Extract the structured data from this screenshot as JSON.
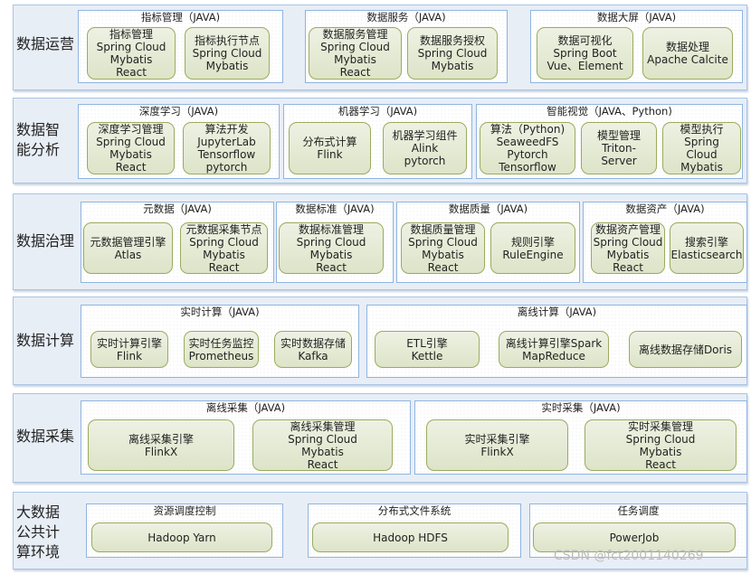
{
  "layers": [
    {
      "label": "数据运营",
      "groups": [
        {
          "title": "指标管理（JAVA)",
          "items": [
            "指标管理\nSpring Cloud\nMybatis\nReact",
            "指标执行节点\nSpring Cloud\nMybatis"
          ]
        },
        {
          "title": "数据服务（JAVA)",
          "items": [
            "数据服务管理\nSpring Cloud\nMybatis\nReact",
            "数据服务授权\nSpring Cloud\nMybatis"
          ]
        },
        {
          "title": "数据大屏（JAVA)",
          "items": [
            "数据可视化\nSpring Boot\nVue、Element",
            "数据处理\nApache Calcite"
          ]
        }
      ]
    },
    {
      "label": "数据智\n能分析",
      "groups": [
        {
          "title": "深度学习（JAVA)",
          "items": [
            "深度学习管理\nSpring Cloud\nMybatis\nReact",
            "算法开发\nJupyterLab\nTensorflow\npytorch"
          ]
        },
        {
          "title": "机器学习（JAVA)",
          "items": [
            "分布式计算\nFlink",
            "机器学习组件\nAlink\npytorch"
          ]
        },
        {
          "title": "智能视觉（JAVA、Python)",
          "items": [
            "算法（Python)\nSeaweedFS\nPytorch\nTensorflow",
            "模型管理\nTriton-\nServer",
            "模型执行\nSpring\nCloud\nMybatis"
          ]
        }
      ]
    },
    {
      "label": "数据治理",
      "groups": [
        {
          "title": "元数据（JAVA)",
          "items": [
            "元数据管理引擎\nAtlas",
            "元数据采集节点\nSpring Cloud\nMybatis\nReact"
          ]
        },
        {
          "title": "数据标准（JAVA)",
          "items": [
            "数据标准管理\nSpring Cloud\nMybatis\nReact"
          ]
        },
        {
          "title": "数据质量（JAVA)",
          "items": [
            "数据质量管理\nSpring Cloud\nMybatis\nReact",
            "规则引擎\nRuleEngine"
          ]
        },
        {
          "title": "数据资产（JAVA)",
          "items": [
            "数据资产管理\nSpring Cloud\nMybatis\nReact",
            "搜索引擎\nElasticsearch"
          ]
        }
      ]
    },
    {
      "label": "数据计算",
      "groups": [
        {
          "title": "实时计算（JAVA)",
          "items": [
            "实时计算引擎\nFlink",
            "实时任务监控\nPrometheus",
            "实时数据存储\nKafka"
          ]
        },
        {
          "title": "离线计算（JAVA)",
          "items": [
            "ETL引擎\nKettle",
            "离线计算引擎Spark\nMapReduce",
            "离线数据存储Doris"
          ]
        }
      ]
    },
    {
      "label": "数据采集",
      "groups": [
        {
          "title": "离线采集（JAVA)",
          "items": [
            "离线采集引擎\nFlinkX",
            "离线采集管理\nSpring Cloud\nMybatis\nReact"
          ]
        },
        {
          "title": "实时采集（JAVA)",
          "items": [
            "实时采集引擎\nFlinkX",
            "实时采集管理\nSpring Cloud\nMybatis\nReact"
          ]
        }
      ]
    },
    {
      "label": "大数据\n公共计\n算环境",
      "groups": [
        {
          "title": "资源调度控制",
          "items": [
            "Hadoop Yarn"
          ]
        },
        {
          "title": "分布式文件系统",
          "items": [
            "Hadoop HDFS"
          ]
        },
        {
          "title": "任务调度",
          "items": [
            "PowerJob"
          ]
        }
      ]
    }
  ],
  "watermark": "CSDN @fct2001140269"
}
